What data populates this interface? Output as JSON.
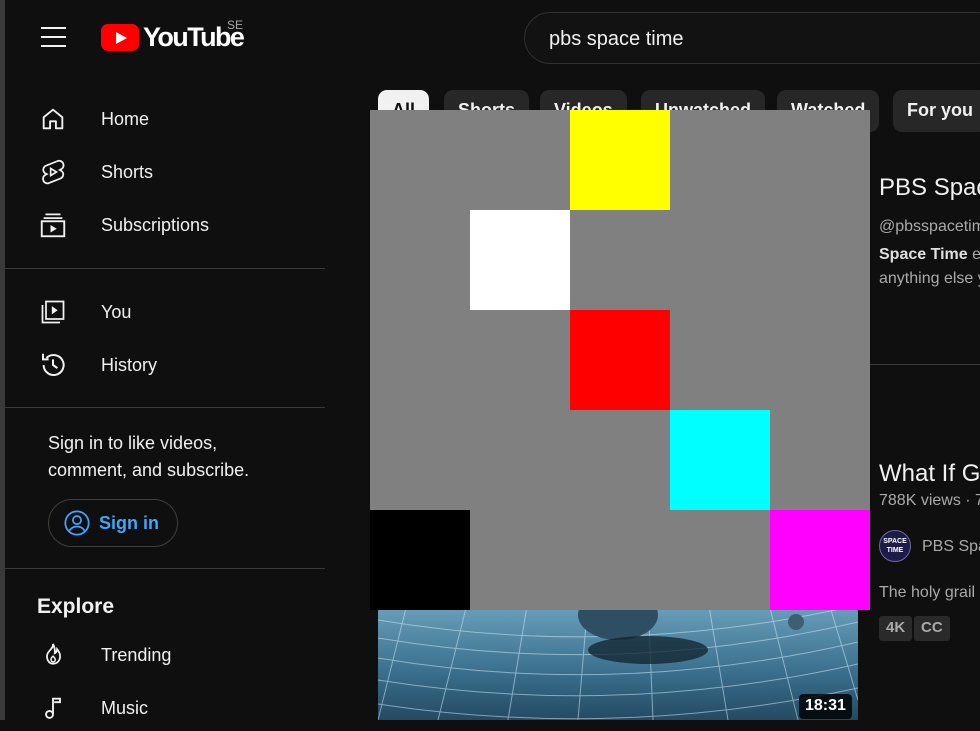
{
  "header": {
    "logo_text": "YouTube",
    "country_code": "SE",
    "search_value": "pbs space time"
  },
  "sidebar": {
    "items": [
      {
        "label": "Home"
      },
      {
        "label": "Shorts"
      },
      {
        "label": "Subscriptions"
      },
      {
        "label": "You"
      },
      {
        "label": "History"
      }
    ],
    "signin_prompt": "Sign in to like videos, comment, and subscribe.",
    "signin_button": "Sign in",
    "explore_heading": "Explore",
    "explore_items": [
      {
        "label": "Trending"
      },
      {
        "label": "Music"
      }
    ]
  },
  "chips": [
    {
      "label": "All"
    },
    {
      "label": "Shorts"
    },
    {
      "label": "Videos"
    },
    {
      "label": "Unwatched"
    },
    {
      "label": "Watched"
    },
    {
      "label": "For you"
    }
  ],
  "results": {
    "channel": {
      "title": "PBS Spac",
      "handle": "@pbsspacetim",
      "desc_bold": "Space Time",
      "desc_rest": " ex",
      "desc_line2": "anything else y"
    },
    "video": {
      "title": "What If Gr",
      "views": "788K views",
      "separator": " · ",
      "age": "7",
      "channel_avatar_text": "SPACE TIME",
      "channel_name": "PBS Spa",
      "description": "The holy grail o",
      "badges": [
        "4K",
        "CC"
      ],
      "duration": "18:31"
    }
  },
  "colors": {
    "background": "#0f0f0f",
    "brand_red": "#ff0000",
    "link_blue": "#3ea6ff",
    "overlay_gray": "#808080"
  }
}
